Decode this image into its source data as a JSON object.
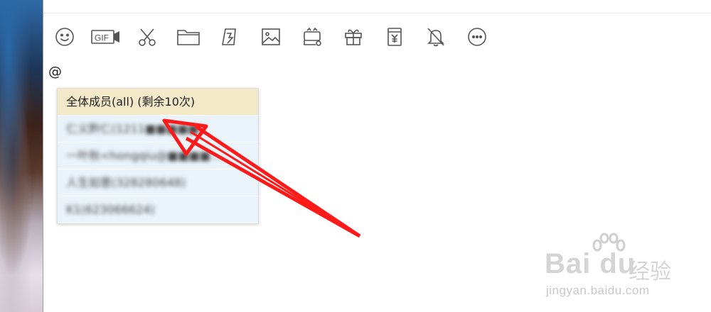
{
  "toolbar": {
    "icons": [
      "emoji-icon",
      "gif-icon",
      "scissors-icon",
      "folder-icon",
      "shake-icon",
      "image-icon",
      "red-packet-icon",
      "gift-icon",
      "transfer-icon",
      "notification-off-icon",
      "more-icon"
    ]
  },
  "input": {
    "text": "@"
  },
  "mention_popup": {
    "items": [
      {
        "label": "全体成员(all) (剩余10次)",
        "selected": true
      },
      {
        "label": "仁义黔仁(1211■■■■■)",
        "selected": false
      },
      {
        "label": "一叶秋<hongqiu@■■■■...",
        "selected": false
      },
      {
        "label": "人生如意(328280648)",
        "selected": false
      },
      {
        "label": "K1(623066624)",
        "selected": false
      }
    ]
  },
  "watermark": {
    "brand": "Bai du",
    "cn": "经验",
    "url": "jingyan.baidu.com"
  },
  "colors": {
    "arrow": "#ff1a1a",
    "selected_bg": "#f3e9c8",
    "item_bg": "#eaf3fa"
  }
}
